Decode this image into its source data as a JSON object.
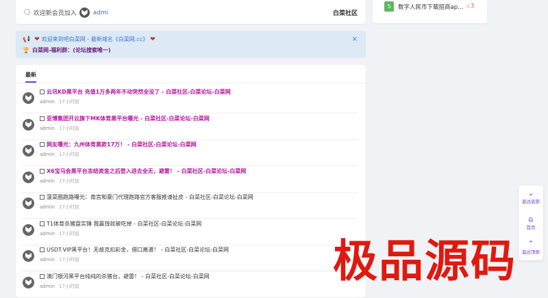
{
  "welcome": {
    "prefix": "欢迎新会员加入",
    "username": "admi",
    "site_name": "白菜社区"
  },
  "right_card": {
    "rank": "5",
    "text": "数字人民币下载招商ap...",
    "hot_count": "3"
  },
  "notice": {
    "line1": "欢迎来到吧白菜网 - 最新域名《白菜网.cc》",
    "line2_emoji": "🏆",
    "line2": "白菜网-福利群：(论坛搜索唯一)",
    "close": "×"
  },
  "main": {
    "tab_label": "最新",
    "items": [
      {
        "title": "云讯KD黑平台 充值1万多两年不动突然全没了 - 白菜社区-白菜论坛-白菜网",
        "author": "admin",
        "time": "17小时前",
        "highlight": true
      },
      {
        "title": "亚博集团开云旗下MK体育黑平台曝光 - 白菜社区-白菜论坛-白菜网",
        "author": "admin",
        "time": "17小时前",
        "highlight": true
      },
      {
        "title": "网友曝光：九州体育黑款17万！ - 白菜社区-白菜论坛-白菜网",
        "author": "admin",
        "time": "17小时前",
        "highlight": true
      },
      {
        "title": "X6宝马会黑平台冻结资金之后登入进去全无，避雷！ - 白菜社区-白菜论坛-白菜网",
        "author": "admin",
        "time": "17小时前",
        "highlight": true
      },
      {
        "title": "菠菜圈跑路曝光：南宫和豪门代理跑路官方客服推诿扯皮 - 白菜社区-白菜论坛-白菜网",
        "author": "admin",
        "time": "17小时前",
        "highlight": false
      },
      {
        "title": "T1体育杀猪盘实锤 我赢钱就被吃掉 - 白菜社区-白菜论坛-白菜网",
        "author": "admin",
        "time": "17小时前",
        "highlight": false
      },
      {
        "title": "USDT.VIP黑平台！无故克扣彩金，借口离谱！ - 白菜社区-白菜论坛-白菜网",
        "author": "admin",
        "time": "17小时前",
        "highlight": false
      },
      {
        "title": "澳门银河黑平台纯纯的杀猪台，避雷！ - 白菜社区-白菜论坛-白菜网",
        "author": "admin",
        "time": "17小时前",
        "highlight": false
      }
    ]
  },
  "side_buttons": {
    "to_bottom": "直达底部",
    "home": "首页",
    "to_top": "直达顶部"
  },
  "watermark": "极品源码",
  "colors": {
    "accent": "#6f3fd8",
    "highlight_title": "#b5179e",
    "notice_bg": "#dde9f5",
    "watermark": "#e0190f"
  }
}
